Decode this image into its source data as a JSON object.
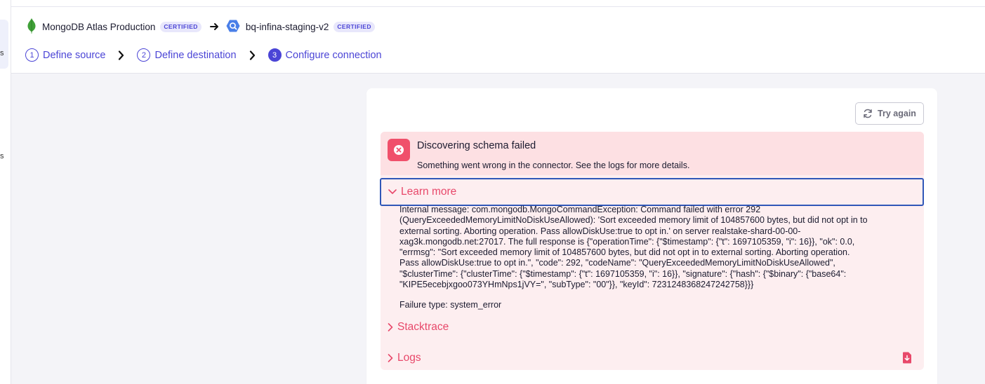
{
  "rail": {
    "text_a": "s",
    "text_b": "s"
  },
  "connection": {
    "source_name": "MongoDB Atlas Production",
    "source_badge": "CERTIFIED",
    "dest_name": "bq-infina-staging-v2",
    "dest_badge": "CERTIFIED"
  },
  "steps": [
    {
      "num": "1",
      "label": "Define source"
    },
    {
      "num": "2",
      "label": "Define destination"
    },
    {
      "num": "3",
      "label": "Configure connection"
    }
  ],
  "card": {
    "try_again_label": "Try again",
    "error_title": "Discovering schema failed",
    "error_subtitle": "Something went wrong in the connector. See the logs for more details.",
    "learn_more_label": "Learn more",
    "internal_message": "Internal message: com.mongodb.MongoCommandException: Command failed with error 292\n(QueryExceededMemoryLimitNoDiskUseAllowed): 'Sort exceeded memory limit of 104857600 bytes, but did not opt in to\nexternal sorting. Aborting operation. Pass allowDiskUse:true to opt in.' on server realstake-shard-00-00-\nxag3k.mongodb.net:27017. The full response is {\"operationTime\": {\"$timestamp\": {\"t\": 1697105359, \"i\": 16}}, \"ok\": 0.0,\n\"errmsg\": \"Sort exceeded memory limit of 104857600 bytes, but did not opt in to external sorting. Aborting operation.\nPass allowDiskUse:true to opt in.\", \"code\": 292, \"codeName\": \"QueryExceededMemoryLimitNoDiskUseAllowed\",\n\"$clusterTime\": {\"clusterTime\": {\"$timestamp\": {\"t\": 1697105359, \"i\": 16}}, \"signature\": {\"hash\": {\"$binary\": {\"base64\":\n\"KIPE5ecebjxgoo073YHmNps1jVY=\", \"subType\": \"00\"}}, \"keyId\": 7231248368247242758}}}",
    "failure_type": "Failure type: system_error",
    "stacktrace_label": "Stacktrace",
    "logs_label": "Logs"
  },
  "colors": {
    "accent": "#4b45d6",
    "error": "#f0506b",
    "error_text": "#e8486a",
    "focus_border": "#2f57b8"
  },
  "icons": {
    "source": "mongodb-leaf-icon",
    "dest": "bigquery-icon",
    "refresh": "refresh-icon",
    "error": "error-x-icon",
    "download": "download-file-icon"
  }
}
